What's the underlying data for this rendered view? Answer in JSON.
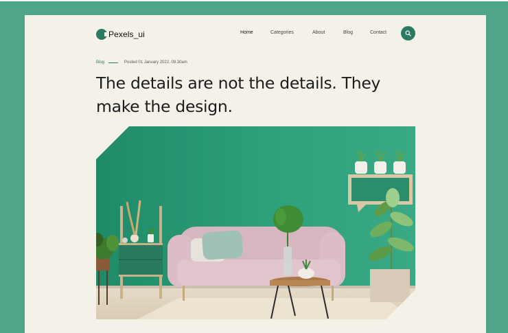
{
  "brand": {
    "name": "Pexels_ui"
  },
  "nav": {
    "items": [
      "Home",
      "Categories",
      "About",
      "Blog",
      "Contact"
    ],
    "active": "Home"
  },
  "post": {
    "category": "Blog",
    "posted": "Posted 01 January 2022, 09.30am",
    "title_line1": "The details are not the details. They",
    "title_line2": "make the design."
  },
  "colors": {
    "accent": "#2d7a62",
    "outer_bg": "#4fa58a",
    "page_bg": "#f3f1e8",
    "wall": "#2f9b78",
    "sofa": "#d9b9c2"
  },
  "icons": {
    "search": "search-icon"
  }
}
